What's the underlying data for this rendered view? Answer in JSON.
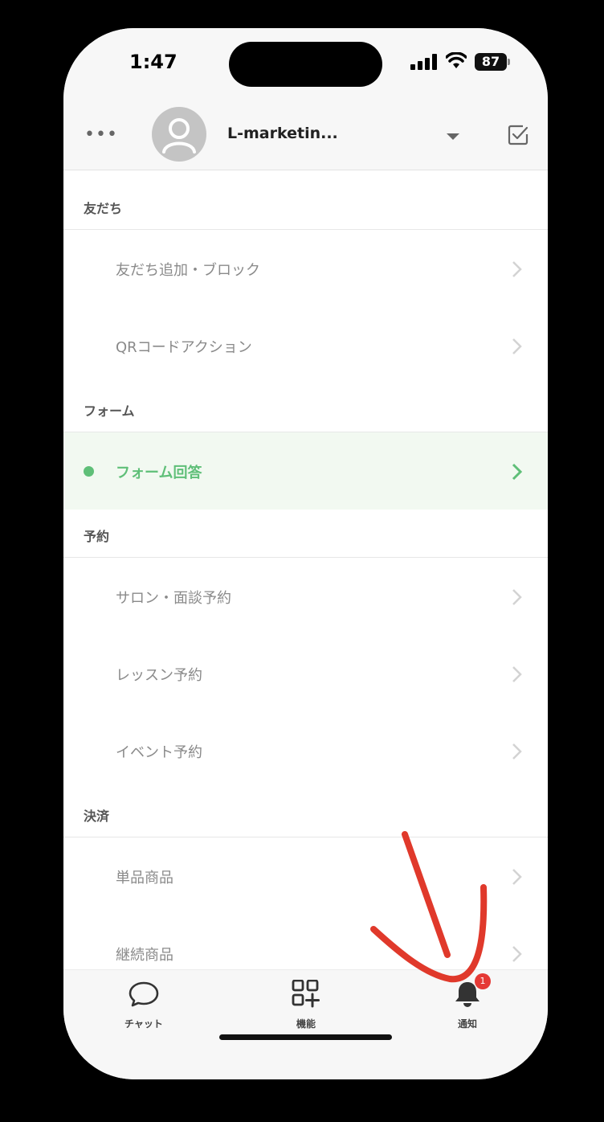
{
  "status_bar": {
    "time": "1:47",
    "battery": "87"
  },
  "header": {
    "more_label": "•••",
    "account_name": "L-marketin..."
  },
  "sections": [
    {
      "title": "友だち",
      "items": [
        "友だち追加・ブロック",
        "QRコードアクション"
      ]
    },
    {
      "title": "フォーム",
      "items": [
        "フォーム回答"
      ]
    },
    {
      "title": "予約",
      "items": [
        "サロン・面談予約",
        "レッスン予約",
        "イベント予約"
      ]
    },
    {
      "title": "決済",
      "items": [
        "単品商品",
        "継続商品"
      ]
    }
  ],
  "active_item": "フォーム回答",
  "tabbar": {
    "tabs": [
      {
        "label": "チャット",
        "icon": "chat-bubble-icon"
      },
      {
        "label": "機能",
        "icon": "grid-plus-icon"
      },
      {
        "label": "通知",
        "icon": "bell-icon",
        "badge": "1"
      }
    ]
  },
  "colors": {
    "accent": "#5fbf78",
    "badge": "#e53935",
    "annotation": "#e0392b"
  }
}
